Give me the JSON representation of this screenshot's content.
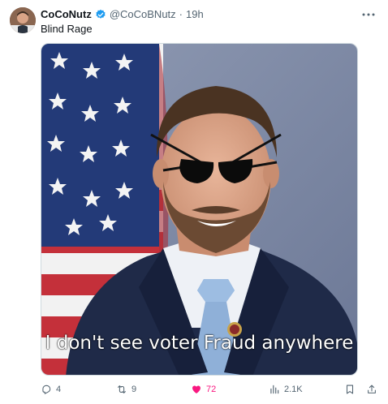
{
  "author": {
    "display_name": "CoCoNutz",
    "handle": "@CoCoBNutz",
    "separator": "·",
    "time": "19h"
  },
  "tweet": {
    "text": "Blind Rage"
  },
  "media": {
    "caption": "I don't see voter Fraud anywhere"
  },
  "actions": {
    "replies": "4",
    "reposts": "9",
    "likes": "72",
    "views": "2.1K"
  },
  "icons": {
    "verified": "verified-badge-icon",
    "more": "more-icon",
    "reply": "reply-icon",
    "repost": "repost-icon",
    "like": "heart-icon",
    "views": "views-icon",
    "bookmark": "bookmark-icon",
    "share": "share-icon"
  },
  "colors": {
    "verified": "#1d9bf0",
    "like_active": "#f91880",
    "secondary_text": "#536471"
  }
}
